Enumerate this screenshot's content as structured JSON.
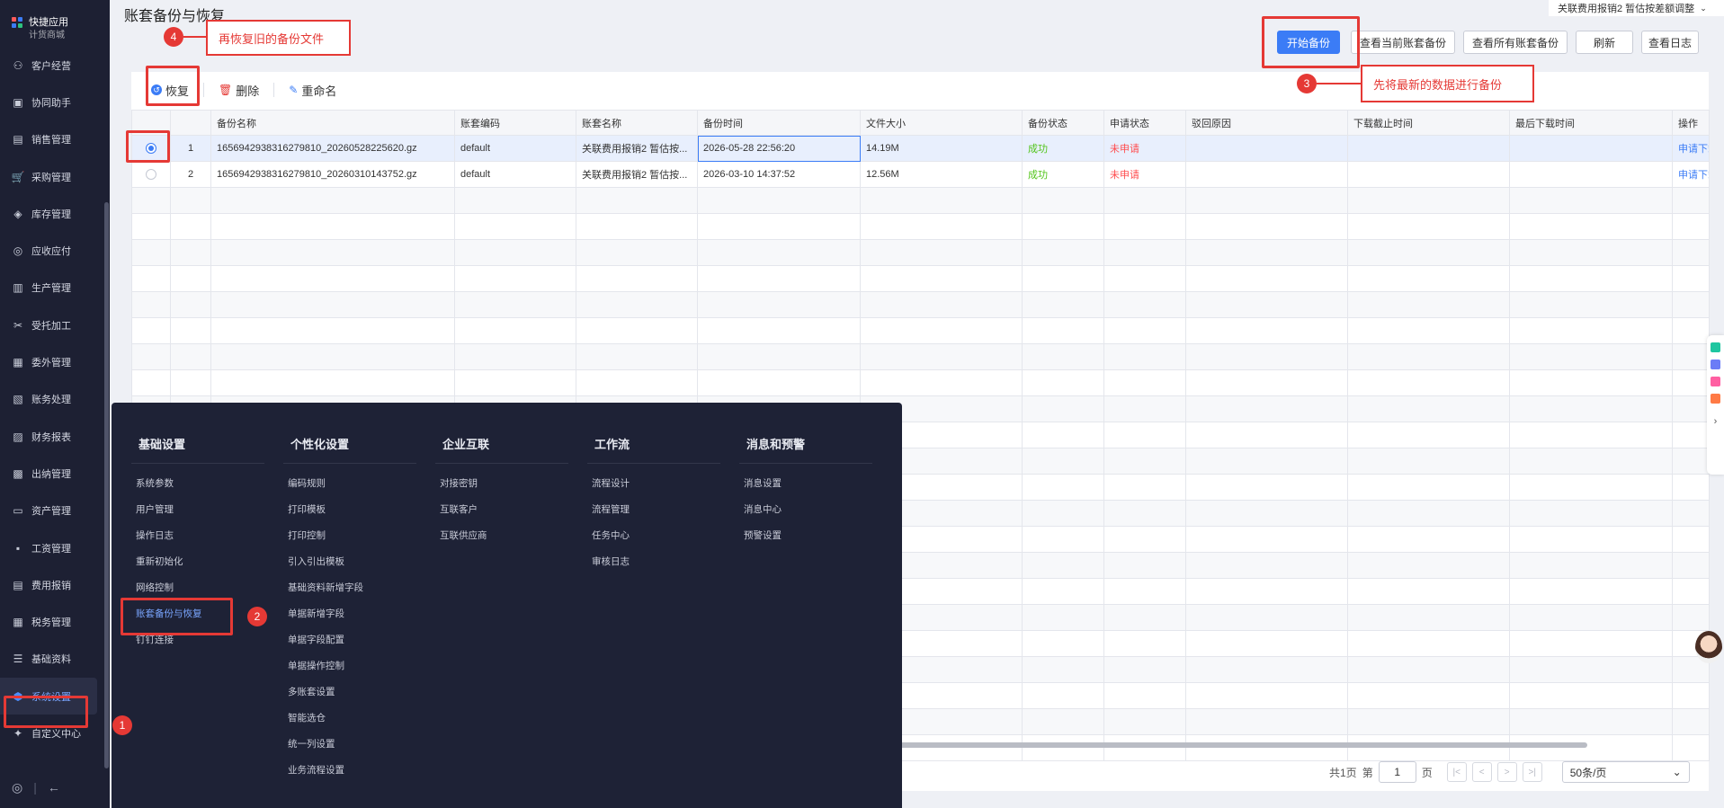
{
  "page": {
    "title": "账套备份与恢复"
  },
  "account_select": {
    "label": "关联费用报销2 暂估按差额调整"
  },
  "sidebar": {
    "top": {
      "line1": "快捷应用",
      "line2": "计货商城"
    },
    "items": [
      {
        "label": "客户经营",
        "icon": "customer-icon"
      },
      {
        "label": "协同助手",
        "icon": "assistant-icon"
      },
      {
        "label": "销售管理",
        "icon": "sales-icon"
      },
      {
        "label": "采购管理",
        "icon": "purchase-icon"
      },
      {
        "label": "库存管理",
        "icon": "inventory-icon"
      },
      {
        "label": "应收应付",
        "icon": "receivable-icon"
      },
      {
        "label": "生产管理",
        "icon": "factory-icon"
      },
      {
        "label": "受托加工",
        "icon": "tools-icon"
      },
      {
        "label": "委外管理",
        "icon": "outsource-icon"
      },
      {
        "label": "账务处理",
        "icon": "ledger-icon"
      },
      {
        "label": "财务报表",
        "icon": "report-icon"
      },
      {
        "label": "出纳管理",
        "icon": "cashier-icon"
      },
      {
        "label": "资产管理",
        "icon": "asset-icon"
      },
      {
        "label": "工资管理",
        "icon": "salary-icon"
      },
      {
        "label": "费用报销",
        "icon": "expense-icon"
      },
      {
        "label": "税务管理",
        "icon": "tax-icon"
      },
      {
        "label": "基础资料",
        "icon": "layers-icon"
      },
      {
        "label": "系统设置",
        "icon": "settings-hex-icon"
      },
      {
        "label": "自定义中心",
        "icon": "custom-icon"
      }
    ]
  },
  "top_buttons": {
    "start_backup": "开始备份",
    "view_current": "查看当前账套备份",
    "view_all": "查看所有账套备份",
    "refresh": "刷新",
    "view_log": "查看日志"
  },
  "toolbar": {
    "restore": "恢复",
    "delete": "删除",
    "rename": "重命名"
  },
  "table": {
    "headers": [
      "",
      "",
      "备份名称",
      "账套编码",
      "账套名称",
      "备份时间",
      "文件大小",
      "备份状态",
      "申请状态",
      "驳回原因",
      "下载截止时间",
      "最后下载时间",
      "操作"
    ],
    "rows": [
      {
        "no": "1",
        "name": "1656942938316279810_20260528225620.gz",
        "code": "default",
        "account": "关联费用报销2 暂估按...",
        "time": "2026-05-28 22:56:20",
        "size": "14.19M",
        "status": "成功",
        "apply": "未申请",
        "reason": "",
        "deadline": "",
        "last": "",
        "op": "申请下载"
      },
      {
        "no": "2",
        "name": "1656942938316279810_20260310143752.gz",
        "code": "default",
        "account": "关联费用报销2 暂估按...",
        "time": "2026-03-10 14:37:52",
        "size": "12.56M",
        "status": "成功",
        "apply": "未申请",
        "reason": "",
        "deadline": "",
        "last": "",
        "op": "申请下载"
      }
    ]
  },
  "pager": {
    "total": "共1页",
    "page_label": "第",
    "page": "1",
    "page_unit": "页",
    "page_size": "50条/页"
  },
  "mega_menu": {
    "columns": [
      {
        "title": "基础设置",
        "items": [
          "系统参数",
          "用户管理",
          "操作日志",
          "重新初始化",
          "网络控制",
          "账套备份与恢复",
          "钉钉连接"
        ]
      },
      {
        "title": "个性化设置",
        "items": [
          "编码规则",
          "打印模板",
          "打印控制",
          "引入引出模板",
          "基础资料新增字段",
          "单据新增字段",
          "单据字段配置",
          "单据操作控制",
          "多账套设置",
          "智能选仓",
          "统一列设置",
          "业务流程设置"
        ]
      },
      {
        "title": "企业互联",
        "items": [
          "对接密钥",
          "互联客户",
          "互联供应商"
        ]
      },
      {
        "title": "工作流",
        "items": [
          "流程设计",
          "流程管理",
          "任务中心",
          "审核日志"
        ]
      },
      {
        "title": "消息和预警",
        "items": [
          "消息设置",
          "消息中心",
          "预警设置"
        ]
      }
    ]
  },
  "annotations": {
    "n1": "1",
    "n2": "2",
    "n3": "3",
    "n4": "4",
    "label3": "先将最新的数据进行备份",
    "label4": "再恢复旧的备份文件"
  },
  "colors": {
    "accent": "#3b7cf6",
    "annotation": "#e53935",
    "sidebar_bg": "#1d2033"
  }
}
